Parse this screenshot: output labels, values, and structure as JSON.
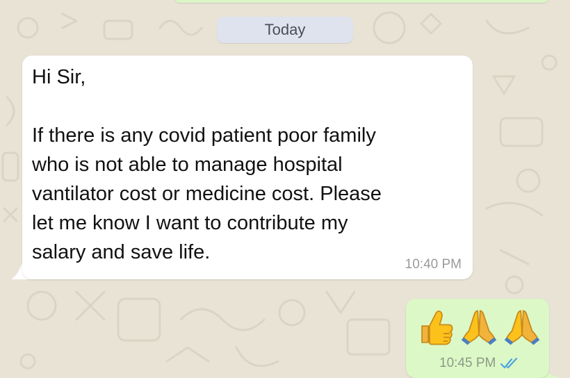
{
  "chat": {
    "date_label": "Today",
    "messages": [
      {
        "direction": "incoming",
        "text": "Hi Sir,\n\nIf there is any covid patient poor family\nwho is not able to manage hospital\nvantilator cost or medicine cost. Please\nlet me know I want to contribute my\nsalary and save life.",
        "time": "10:40 PM"
      },
      {
        "direction": "outgoing",
        "emojis": [
          "thumbs-up",
          "folded-hands",
          "folded-hands"
        ],
        "time": "10:45 PM",
        "status": "read"
      }
    ]
  },
  "colors": {
    "wallpaper": "#e9e3d6",
    "incoming_bubble": "#ffffff",
    "outgoing_bubble": "#dcf8c6",
    "date_chip": "#dfe3ee",
    "read_ticks": "#4fa3e0"
  }
}
